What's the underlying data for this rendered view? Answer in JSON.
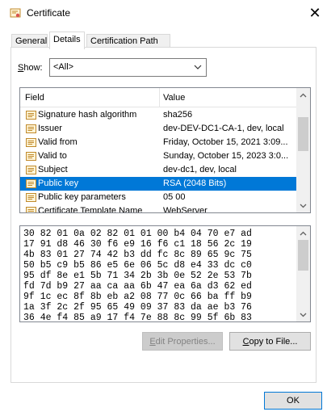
{
  "window": {
    "title": "Certificate",
    "close_label": "✕"
  },
  "tabs": [
    {
      "label": "General"
    },
    {
      "label": "Details"
    },
    {
      "label": "Certification Path"
    }
  ],
  "show": {
    "label": "Show:",
    "value": "<All>"
  },
  "list": {
    "headers": {
      "field": "Field",
      "value": "Value"
    },
    "rows": [
      {
        "field": "Signature hash algorithm",
        "value": "sha256"
      },
      {
        "field": "Issuer",
        "value": "dev-DEV-DC1-CA-1, dev, local"
      },
      {
        "field": "Valid from",
        "value": "Friday, October 15, 2021 3:09..."
      },
      {
        "field": "Valid to",
        "value": "Sunday, October 15, 2023 3:0..."
      },
      {
        "field": "Subject",
        "value": "dev-dc1, dev, local"
      },
      {
        "field": "Public key",
        "value": "RSA (2048 Bits)"
      },
      {
        "field": "Public key parameters",
        "value": "05 00"
      },
      {
        "field": "Certificate Template Name",
        "value": "WebServer"
      }
    ],
    "selected_index": 5
  },
  "hex_lines": [
    "30 82 01 0a 02 82 01 01 00 b4 04 70 e7 ad",
    "17 91 d8 46 30 f6 e9 16 f6 c1 18 56 2c 19",
    "4b 83 01 27 74 42 b3 dd fc 8c 89 65 9c 75",
    "50 b5 c9 b5 86 e5 6e 06 5c d8 e4 33 dc c0",
    "95 df 8e e1 5b 71 34 2b 3b 0e 52 2e 53 7b",
    "fd 7d b9 27 aa ca aa 6b 47 ea 6a d3 62 ed",
    "9f 1c ec 8f 8b eb a2 08 77 0c 66 ba ff b9",
    "1a 3f 2c 2f 95 65 49 09 37 83 da ae b3 76",
    "36 4e f4 85 a9 17 f4 7e 88 8c 99 5f 6b 83"
  ],
  "buttons": {
    "edit_properties": {
      "underline": "E",
      "rest": "dit Properties..."
    },
    "copy_to_file": {
      "underline": "C",
      "rest": "opy to File..."
    },
    "ok": "OK"
  },
  "icons": {
    "title": "certificate-icon",
    "row": "certificate-field-icon",
    "close": "close-icon"
  }
}
